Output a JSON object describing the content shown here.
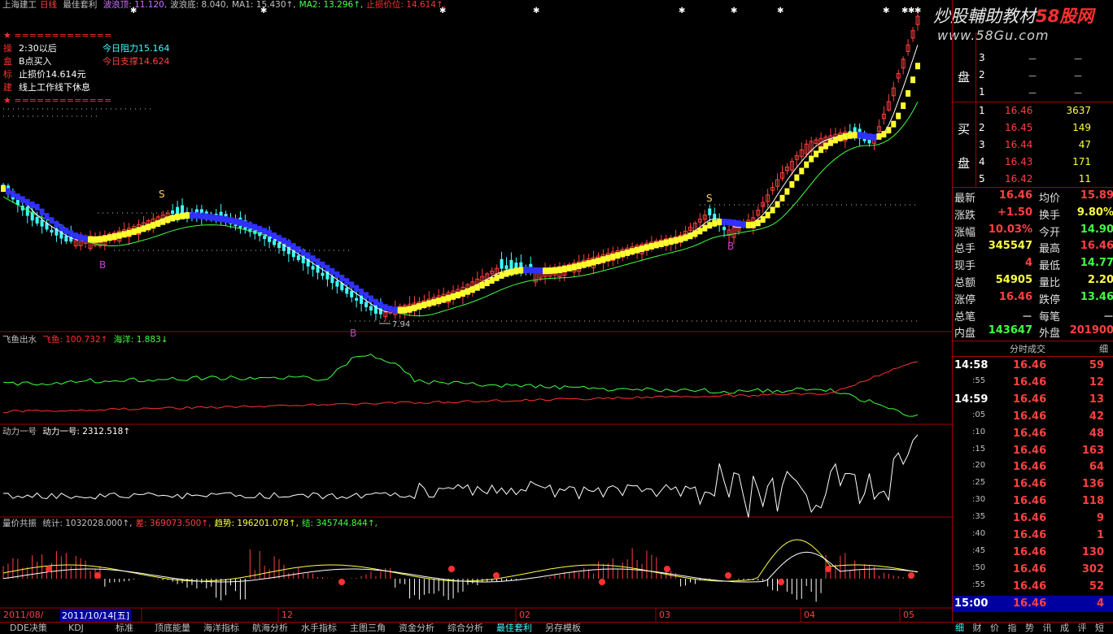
{
  "header": {
    "stock": "上海建工",
    "period": "日线",
    "strategy": "最佳套利",
    "items": [
      {
        "label": "波浪顶: ",
        "value": "11.120,",
        "color": "#d070ff"
      },
      {
        "label": "波浪底: ",
        "value": "8.040,",
        "color": "#c0c0c0"
      },
      {
        "label": "MA1: ",
        "value": "15.430↑,",
        "color": "#c0c0c0"
      },
      {
        "label": "MA2: ",
        "value": "13.296↑,",
        "color": "#50ff50"
      },
      {
        "label": "止损价位: ",
        "value": "14.614↑,",
        "color": "#ff3030"
      }
    ]
  },
  "info_box": {
    "star_line": "★ =============",
    "lines": [
      {
        "tag": "操",
        "text": "2:30以后"
      },
      {
        "tag": "盒",
        "text": "B点买入"
      },
      {
        "tag": "标",
        "text": "止损价14.614元"
      },
      {
        "tag": "建",
        "text": "线上工作线下休息"
      }
    ],
    "star_line2": "★ =============",
    "resistance": "今日阻力15.164",
    "support": "今日支撑14.624"
  },
  "watermark": {
    "text": "炒股輔助教材",
    "url": "58股网",
    "site": "www.58Gu.com"
  },
  "main_labels": {
    "s1": "S",
    "b1": "B",
    "s2": "S",
    "b2": "B",
    "b3": "B",
    "low": "7.94"
  },
  "panels": {
    "feiyu": {
      "title": "飞鱼出水",
      "name1": "飞鱼: ",
      "val1": "100.732↑",
      "name2": "海洋: ",
      "val2": "1.883↓"
    },
    "dongli": {
      "title": "动力一号",
      "name1": "动力一号: ",
      "val1": "2312.518↑"
    },
    "liangjia": {
      "title": "量价共振",
      "items": [
        {
          "label": "统计: ",
          "value": "1032028.000↑,",
          "color": "#c0c0c0"
        },
        {
          "label": "差: ",
          "value": "369073.500↑,",
          "color": "#ff4040"
        },
        {
          "label": "趋势: ",
          "value": "196201.078↑,",
          "color": "#ffff40"
        },
        {
          "label": "结: ",
          "value": "345744.844↑,",
          "color": "#40ff40"
        }
      ]
    }
  },
  "x_axis": {
    "start": "2011/08/",
    "cursor_date": "2011/10/14[五]",
    "ticks": [
      "12",
      "02",
      "03",
      "04",
      "05"
    ]
  },
  "orderbook": {
    "sell": [
      {
        "n": "3",
        "price": "－",
        "vol": "－"
      },
      {
        "n": "2",
        "price": "－",
        "vol": "－"
      },
      {
        "n": "1",
        "price": "－",
        "vol": "－"
      }
    ],
    "sell_label": "盘",
    "buy_label1": "买",
    "buy_label2": "盘",
    "buy": [
      {
        "n": "1",
        "price": "16.46",
        "vol": "3637"
      },
      {
        "n": "2",
        "price": "16.45",
        "vol": "149"
      },
      {
        "n": "3",
        "price": "16.44",
        "vol": "47"
      },
      {
        "n": "4",
        "price": "16.43",
        "vol": "171"
      },
      {
        "n": "5",
        "price": "16.42",
        "vol": "11"
      }
    ]
  },
  "quote": [
    {
      "l1": "最新",
      "v1": "16.46",
      "c1": "#ff4040",
      "l2": "均价",
      "v2": "15.89",
      "c2": "#ff4040"
    },
    {
      "l1": "涨跌",
      "v1": "+1.50",
      "c1": "#ff4040",
      "l2": "换手",
      "v2": "9.80%",
      "c2": "#ffff40"
    },
    {
      "l1": "涨幅",
      "v1": "10.03%",
      "c1": "#ff4040",
      "l2": "今开",
      "v2": "14.90",
      "c2": "#40ff40"
    },
    {
      "l1": "总手",
      "v1": "345547",
      "c1": "#ffff40",
      "l2": "最高",
      "v2": "16.46",
      "c2": "#ff4040"
    },
    {
      "l1": "现手",
      "v1": "4",
      "c1": "#ff4040",
      "l2": "最低",
      "v2": "14.77",
      "c2": "#40ff40"
    },
    {
      "l1": "总额",
      "v1": "54905",
      "c1": "#ffff40",
      "l2": "量比",
      "v2": "2.20",
      "c2": "#ffff40"
    },
    {
      "l1": "涨停",
      "v1": "16.46",
      "c1": "#ff4040",
      "l2": "跌停",
      "v2": "13.46",
      "c2": "#40ff40"
    },
    {
      "l1": "总笔",
      "v1": "－",
      "c1": "#c0c0c0",
      "l2": "每笔",
      "v2": "－",
      "c2": "#c0c0c0"
    },
    {
      "l1": "内盘",
      "v1": "143647",
      "c1": "#40ff40",
      "l2": "外盘",
      "v2": "201900",
      "c2": "#ff4040"
    }
  ],
  "ticks_panel": {
    "title": "分时成交",
    "corner": "细",
    "rows": [
      {
        "t": "14:58",
        "p": "16.46",
        "v": "59",
        "big": true
      },
      {
        "t": ":55",
        "p": "16.46",
        "v": "12",
        "big": false
      },
      {
        "t": "14:59",
        "p": "16.46",
        "v": "13",
        "big": true
      },
      {
        "t": ":05",
        "p": "16.46",
        "v": "42",
        "big": false
      },
      {
        "t": ":10",
        "p": "16.46",
        "v": "48",
        "big": false
      },
      {
        "t": ":15",
        "p": "16.46",
        "v": "163",
        "big": false
      },
      {
        "t": ":20",
        "p": "16.46",
        "v": "64",
        "big": false
      },
      {
        "t": ":25",
        "p": "16.46",
        "v": "136",
        "big": false
      },
      {
        "t": ":30",
        "p": "16.46",
        "v": "118",
        "big": false
      },
      {
        "t": ":35",
        "p": "16.46",
        "v": "9",
        "big": false
      },
      {
        "t": ":40",
        "p": "16.46",
        "v": "1",
        "big": false
      },
      {
        "t": ":45",
        "p": "16.46",
        "v": "130",
        "big": false
      },
      {
        "t": ":50",
        "p": "16.46",
        "v": "302",
        "big": false
      },
      {
        "t": ":55",
        "p": "16.46",
        "v": "52",
        "big": false
      }
    ],
    "last": {
      "t": "15:00",
      "p": "16.46",
      "v": "4"
    }
  },
  "bottom_tabs": [
    "DDE决策",
    "KDJ",
    "标准",
    "顶底能量",
    "海洋指标",
    "航海分析",
    "水手指标",
    "主图三角",
    "资金分析",
    "综合分析",
    "最佳套利",
    "另存模板"
  ],
  "side_tabs": [
    "细",
    "财",
    "价",
    "指",
    "势",
    "讯",
    "成",
    "评",
    "短"
  ]
}
